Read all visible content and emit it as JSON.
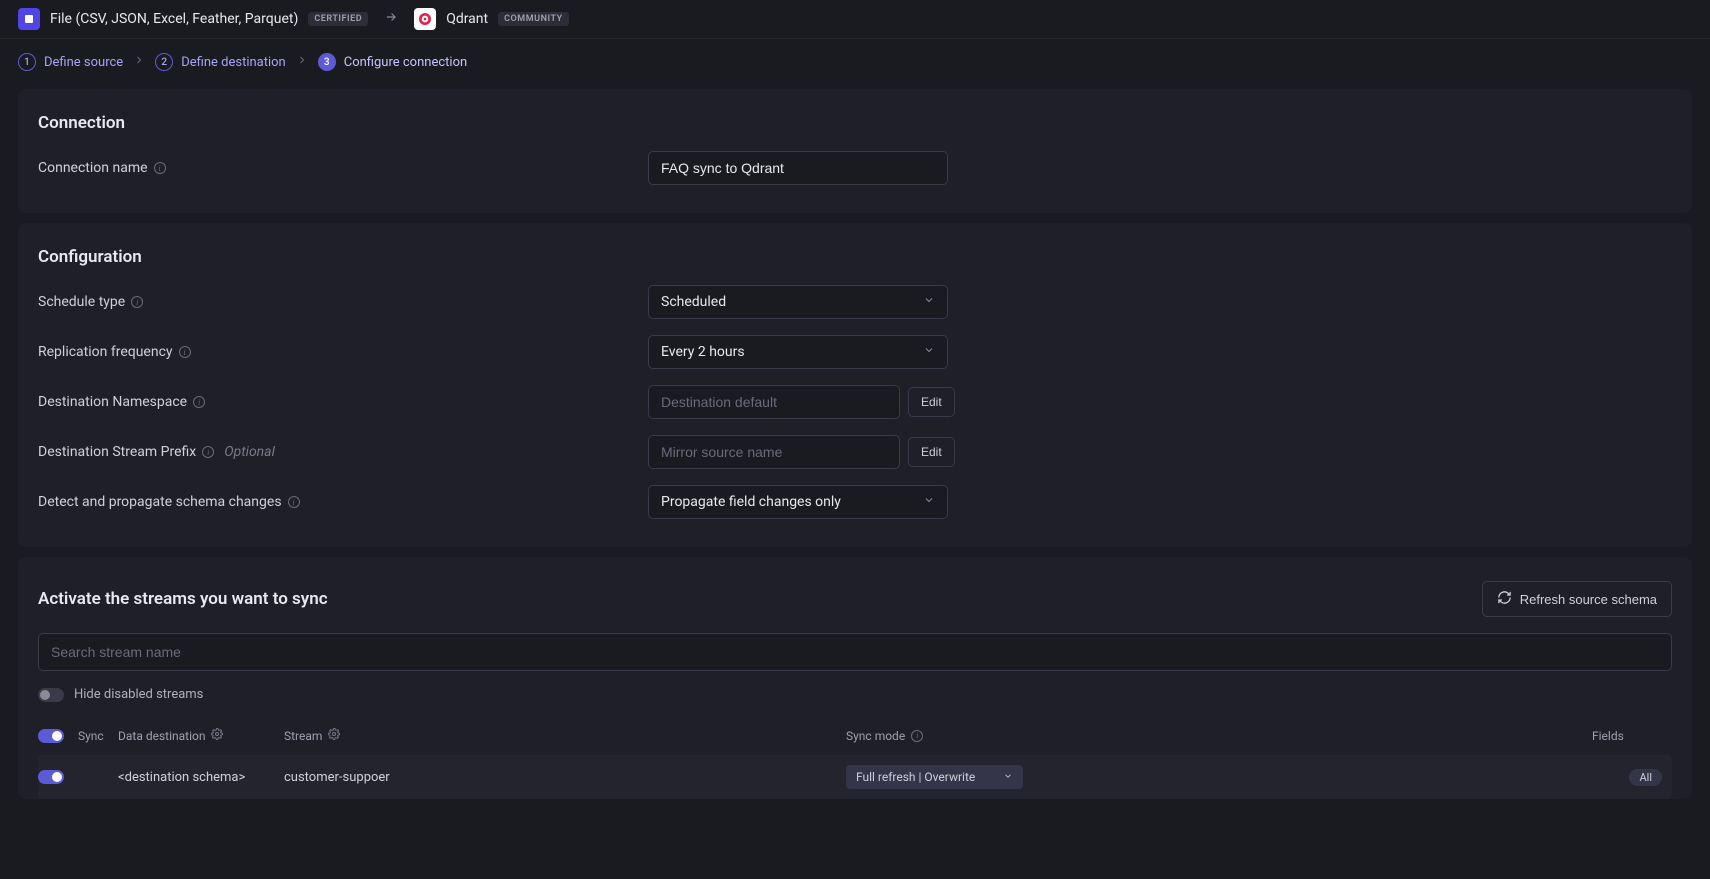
{
  "header": {
    "source_name": "File (CSV, JSON, Excel, Feather, Parquet)",
    "source_badge": "CERTIFIED",
    "dest_name": "Qdrant",
    "dest_badge": "COMMUNITY"
  },
  "stepper": {
    "steps": [
      {
        "num": "1",
        "label": "Define source"
      },
      {
        "num": "2",
        "label": "Define destination"
      },
      {
        "num": "3",
        "label": "Configure connection"
      }
    ]
  },
  "connection": {
    "title": "Connection",
    "name_label": "Connection name",
    "name_value": "FAQ sync to Qdrant"
  },
  "configuration": {
    "title": "Configuration",
    "schedule_label": "Schedule type",
    "schedule_value": "Scheduled",
    "replication_label": "Replication frequency",
    "replication_value": "Every 2 hours",
    "namespace_label": "Destination Namespace",
    "namespace_value": "Destination default",
    "prefix_label": "Destination Stream Prefix",
    "prefix_optional": "Optional",
    "prefix_placeholder": "Mirror source name",
    "schema_label": "Detect and propagate schema changes",
    "schema_value": "Propagate field changes only",
    "edit_label": "Edit"
  },
  "streams": {
    "title": "Activate the streams you want to sync",
    "refresh_label": "Refresh source schema",
    "search_placeholder": "Search stream name",
    "hide_disabled_label": "Hide disabled streams",
    "cols": {
      "sync": "Sync",
      "data_dest": "Data destination",
      "stream": "Stream",
      "sync_mode": "Sync mode",
      "fields": "Fields"
    },
    "row": {
      "data_dest": "<destination schema>",
      "stream": "customer-suppoer",
      "sync_mode": "Full refresh | Overwrite",
      "fields": "All"
    }
  }
}
